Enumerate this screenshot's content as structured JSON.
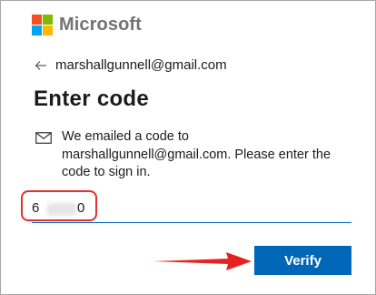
{
  "brand": {
    "logo_icon": "microsoft-logo-icon",
    "name": "Microsoft",
    "colors": {
      "red": "#f25022",
      "green": "#7fba00",
      "blue": "#00a4ef",
      "yellow": "#ffb900"
    }
  },
  "identity": {
    "back_icon": "arrow-left-icon",
    "email": "marshallgunnell@gmail.com"
  },
  "title": "Enter code",
  "message": {
    "icon": "envelope-icon",
    "text": "We emailed a code to marshallgunnell@gmail.com. Please enter the code to sign in."
  },
  "code_input": {
    "first_digit": "6",
    "last_digit": "0",
    "middle_obscured": true
  },
  "annotations": {
    "highlight_color": "#e23030",
    "arrow_color": "#e52222"
  },
  "verify_button": {
    "label": "Verify",
    "color": "#0067b8"
  }
}
